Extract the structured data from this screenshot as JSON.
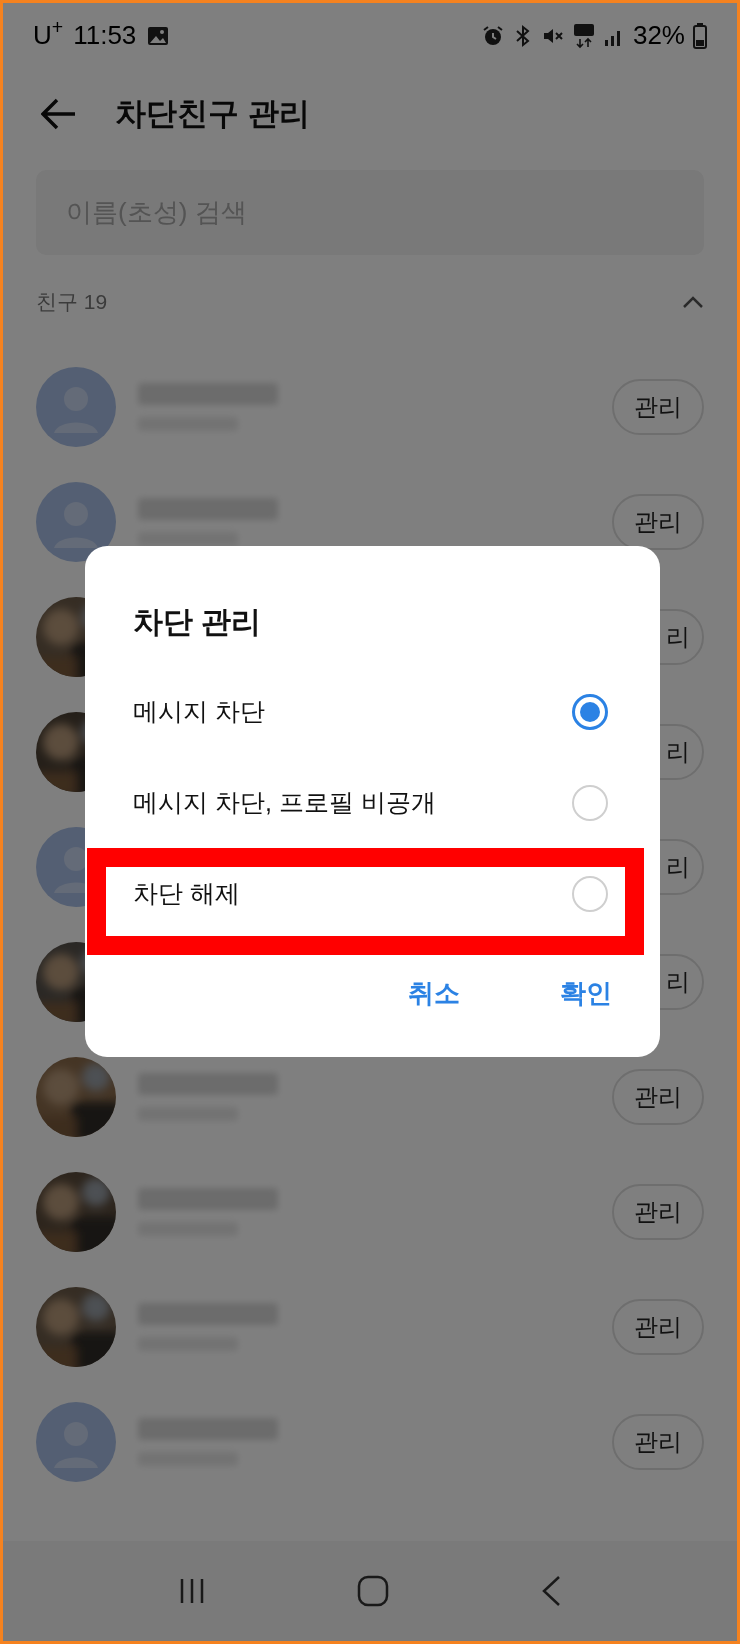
{
  "status_bar": {
    "carrier": "U$^{+}$",
    "time": "11:53",
    "battery": "32%"
  },
  "header": {
    "title": "차단친구 관리"
  },
  "search": {
    "placeholder": "이름(초성) 검색"
  },
  "section": {
    "label": "친구 19",
    "expanded": true
  },
  "rows": [
    {
      "kind": "default",
      "partly_hidden": false,
      "button": "관리"
    },
    {
      "kind": "default",
      "partly_hidden": false,
      "button": "관리"
    },
    {
      "partly_hidden": true,
      "button": "리"
    },
    {
      "partly_hidden": true,
      "button": "리"
    },
    {
      "kind": "default",
      "partly_hidden": true,
      "button": "리"
    },
    {
      "partly_hidden": true,
      "button": "리"
    },
    {
      "partly_hidden": false,
      "button": "관리"
    },
    {
      "partly_hidden": false,
      "button": "관리"
    },
    {
      "partly_hidden": false,
      "button": "관리"
    },
    {
      "kind": "default",
      "partly_hidden": false,
      "button": "관리"
    }
  ],
  "dialog": {
    "title": "차단 관리",
    "options": [
      {
        "label": "메시지 차단",
        "selected": true,
        "highlighted": false
      },
      {
        "label": "메시지 차단, 프로필 비공개",
        "selected": false,
        "highlighted": false
      },
      {
        "label": "차단 해제",
        "selected": false,
        "highlighted": true
      }
    ],
    "buttons": [
      {
        "label": "취소"
      },
      {
        "label": "확인"
      }
    ]
  }
}
